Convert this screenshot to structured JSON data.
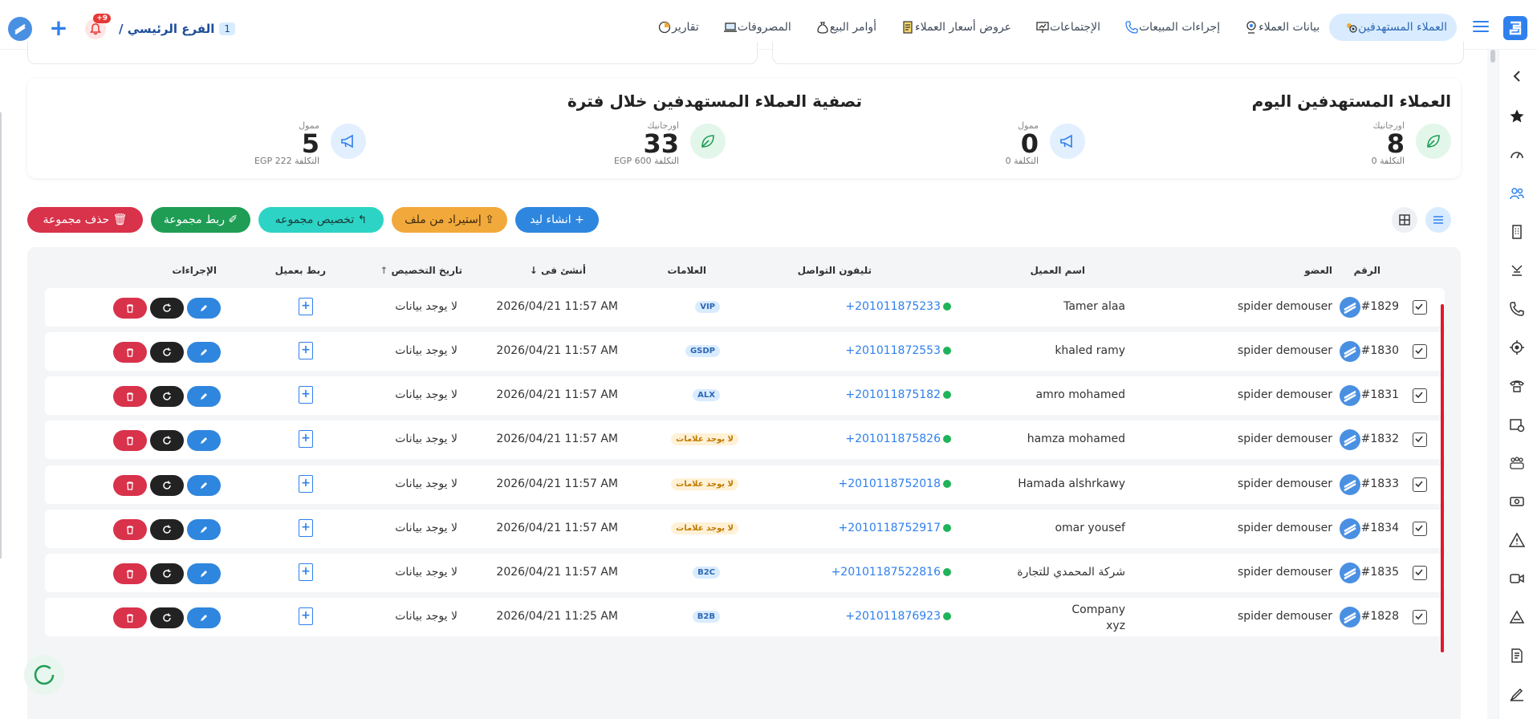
{
  "topbar": {
    "nav": [
      {
        "label": "العملاء المستهدفين",
        "icon": "target-people-icon",
        "active": true
      },
      {
        "label": "بيانات العملاء",
        "icon": "customer-data-icon"
      },
      {
        "label": "إجراءات المبيعات",
        "icon": "phone-icon"
      },
      {
        "label": "الإجتماعات",
        "icon": "presentation-icon"
      },
      {
        "label": "عروض أسعار العملاء",
        "icon": "quote-icon"
      },
      {
        "label": "أوامر البيع",
        "icon": "money-bag-icon"
      },
      {
        "label": "المصروفات",
        "icon": "laptop-icon"
      },
      {
        "label": "تقارير",
        "icon": "chart-icon"
      }
    ],
    "branch_name": "الفرع الرئيسي /",
    "branch_count": "1",
    "notification_count": "+9"
  },
  "stats": {
    "today_title": "العملاء المستهدفين اليوم",
    "period_title": "تصفية العملاء المستهدفين خلال فترة",
    "items": [
      {
        "label": "اورجانيك",
        "value": "8",
        "cost": "التكلفة 0"
      },
      {
        "label": "ممول",
        "value": "0",
        "cost": "التكلفة 0"
      },
      {
        "label": "اورجانيك",
        "value": "33",
        "cost": "التكلفة EGP 600"
      },
      {
        "label": "ممول",
        "value": "5",
        "cost": "التكلفة EGP 222"
      }
    ]
  },
  "actions": {
    "create_lead": "+ انشاء ليد",
    "import_file": "⇪ إستيراد من ملف",
    "assign_group": "↰ تخصيص مجموعه",
    "link_group": "✐ ربط مجموعة",
    "delete_group": "🗑 حذف مجموعة"
  },
  "table": {
    "headers": {
      "number": "الرقم",
      "member": "العضو",
      "client_name": "اسم العميل",
      "phone": "تليفون التواصل",
      "tags": "العلامات",
      "created_at": "أنشئ فى",
      "assign_date": "تاريخ التخصيص",
      "link_client": "ربط بعميل",
      "actions": "الإجراءات"
    },
    "rows": [
      {
        "id": "#1829",
        "member": "spider demouser",
        "name": "Tamer alaa",
        "phone": "+201011875233",
        "tag": "VIP",
        "tag_none": false,
        "created": "2026/04/21 11:57 AM",
        "assigned": "لا يوجد بيانات"
      },
      {
        "id": "#1830",
        "member": "spider demouser",
        "name": "khaled ramy",
        "phone": "+201011872553",
        "tag": "GSDP",
        "tag_none": false,
        "created": "2026/04/21 11:57 AM",
        "assigned": "لا يوجد بيانات"
      },
      {
        "id": "#1831",
        "member": "spider demouser",
        "name": "amro mohamed",
        "phone": "+201011875182",
        "tag": "ALX",
        "tag_none": false,
        "created": "2026/04/21 11:57 AM",
        "assigned": "لا يوجد بيانات"
      },
      {
        "id": "#1832",
        "member": "spider demouser",
        "name": "hamza mohamed",
        "phone": "+201011875826",
        "tag": "لا يوجد علامات",
        "tag_none": true,
        "created": "2026/04/21 11:57 AM",
        "assigned": "لا يوجد بيانات"
      },
      {
        "id": "#1833",
        "member": "spider demouser",
        "name": "Hamada alshrkawy",
        "phone": "+2010118752018",
        "tag": "لا يوجد علامات",
        "tag_none": true,
        "created": "2026/04/21 11:57 AM",
        "assigned": "لا يوجد بيانات"
      },
      {
        "id": "#1834",
        "member": "spider demouser",
        "name": "omar yousef",
        "phone": "+2010118752917",
        "tag": "لا يوجد علامات",
        "tag_none": true,
        "created": "2026/04/21 11:57 AM",
        "assigned": "لا يوجد بيانات"
      },
      {
        "id": "#1835",
        "member": "spider demouser",
        "name": "شركة المحمدي للتجارة",
        "phone": "+20101187522816",
        "tag": "B2C",
        "tag_none": false,
        "created": "2026/04/21 11:57 AM",
        "assigned": "لا يوجد بيانات"
      },
      {
        "id": "#1828",
        "member": "spider demouser",
        "name": "Company xyz",
        "phone": "+201011876923",
        "tag": "B2B",
        "tag_none": false,
        "created": "2026/04/21 11:25 AM",
        "assigned": "لا يوجد بيانات"
      }
    ]
  },
  "colors": {
    "accent": "#2f80ed",
    "danger": "#d9324b",
    "success": "#1f9d55",
    "highlight": "#e0192c"
  }
}
